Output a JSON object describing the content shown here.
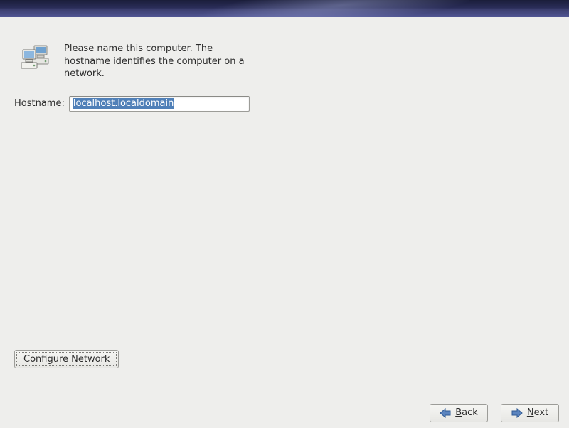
{
  "intro": {
    "icon": "computers-icon",
    "text": "Please name this computer.  The hostname identifies the computer on a network."
  },
  "form": {
    "hostname_label": "Hostname:",
    "hostname_value": "localhost.localdomain"
  },
  "buttons": {
    "configure_network": "Configure Network",
    "back_prefix_underlined": "B",
    "back_rest": "ack",
    "next_prefix_underlined": "N",
    "next_rest": "ext"
  }
}
